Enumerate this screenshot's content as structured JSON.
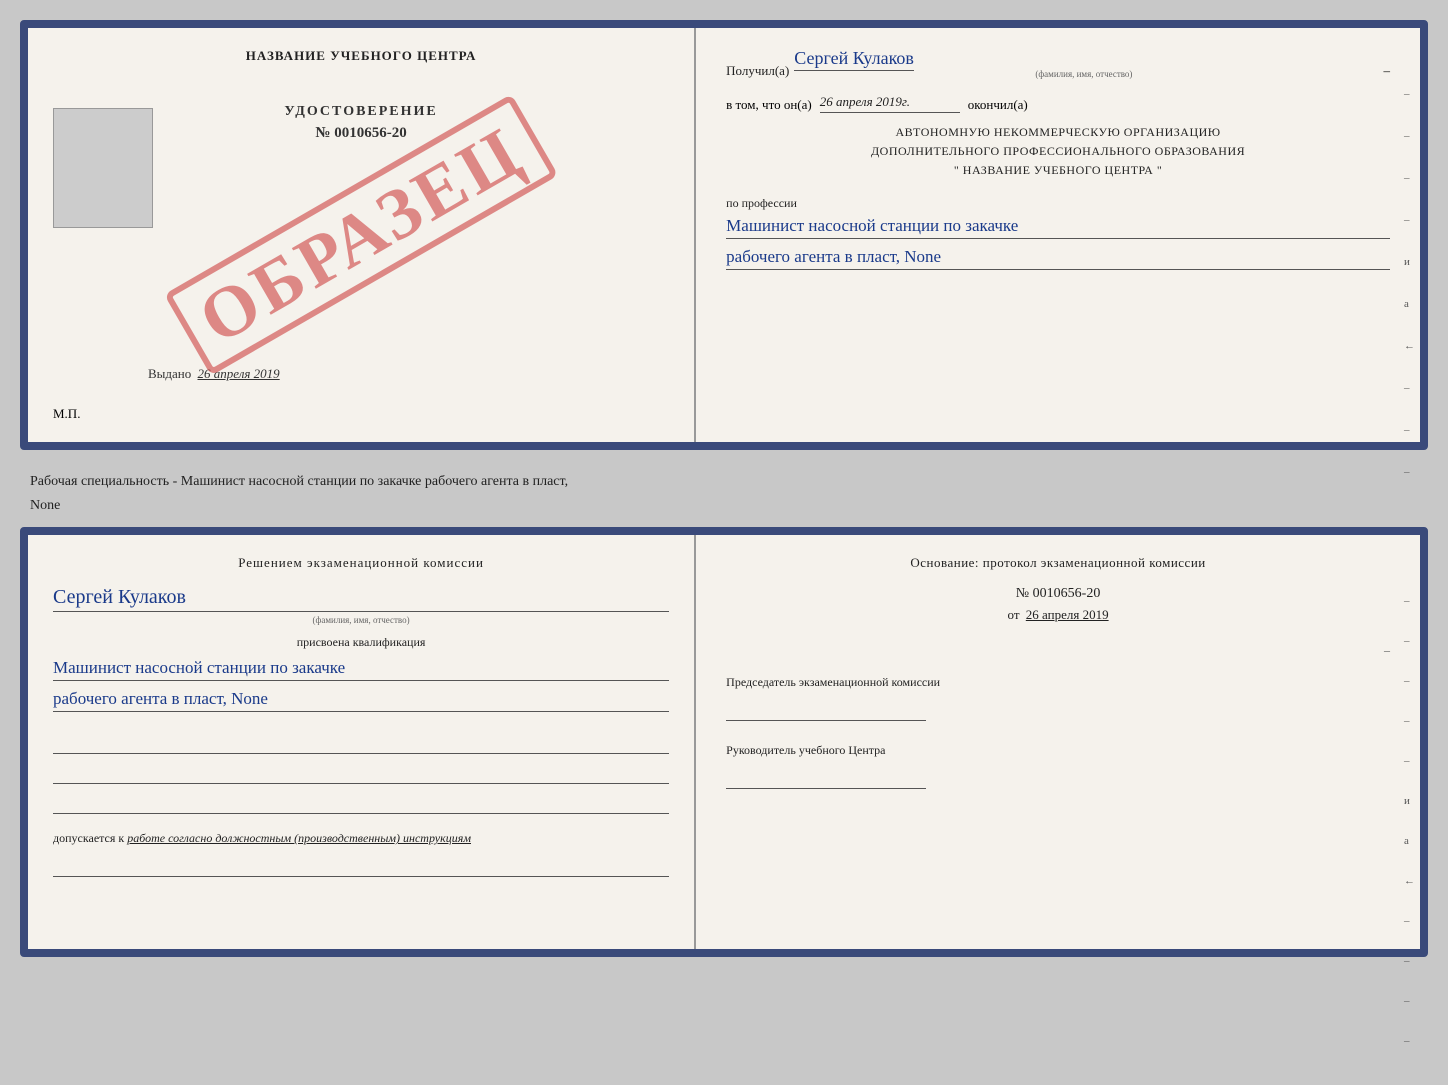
{
  "background": "#c8c8c8",
  "doc_top": {
    "left": {
      "title": "НАЗВАНИЕ УЧЕБНОГО ЦЕНТРА",
      "stamp": "ОБРАЗЕЦ",
      "udostoverenie_label": "УДОСТОВЕРЕНИЕ",
      "udostoverenie_number": "№ 0010656-20",
      "vydano_label": "Выдано",
      "vydano_date": "26 апреля 2019",
      "mp_label": "М.П."
    },
    "right": {
      "poluchil_label": "Получил(a)",
      "name_handwritten": "Сергей Кулаков",
      "name_hint": "(фамилия, имя, отчество)",
      "dash1": "–",
      "vtom_label": "в том, что он(а)",
      "vtom_date": "26 апреля 2019г.",
      "okonchil_label": "окончил(а)",
      "org_line1": "АВТОНОМНУЮ НЕКОММЕРЧЕСКУЮ ОРГАНИЗАЦИЮ",
      "org_line2": "ДОПОЛНИТЕЛЬНОГО ПРОФЕССИОНАЛЬНОГО ОБРАЗОВАНИЯ",
      "org_line3": "\"   НАЗВАНИЕ УЧЕБНОГО ЦЕНТРА   \"",
      "po_professii": "по профессии",
      "profession_line1": "Машинист насосной станции по закачке",
      "profession_line2": "рабочего агента в пласт, None",
      "side_marks": [
        "–",
        "–",
        "–",
        "–",
        "и",
        "а",
        "←",
        "–",
        "–",
        "–"
      ]
    }
  },
  "subtitle": "Рабочая специальность - Машинист насосной станции по закачке рабочего агента в пласт,",
  "subtitle2": "None",
  "doc_bottom": {
    "left": {
      "resheniem_title": "Решением экзаменационной комиссии",
      "name_handwritten": "Сергей Кулаков",
      "name_hint": "(фамилия, имя, отчество)",
      "prisvoyena": "присвоена квалификация",
      "profession_line1": "Машинист насосной станции по закачке",
      "profession_line2": "рабочего агента в пласт, None",
      "dopuskaetsya_label": "допускается к",
      "dopuskaetsya_value": "работе согласно должностным (производственным) инструкциям"
    },
    "right": {
      "osnovanie_title": "Основание: протокол экзаменационной комиссии",
      "number_label": "№ 0010656-20",
      "ot_label": "от",
      "ot_date": "26 апреля 2019",
      "predsedatel_label": "Председатель экзаменационной комиссии",
      "rukovoditel_label": "Руководитель учебного Центра",
      "side_marks": [
        "–",
        "–",
        "–",
        "–",
        "–",
        "и",
        "а",
        "←",
        "–",
        "–",
        "–",
        "–"
      ]
    }
  }
}
